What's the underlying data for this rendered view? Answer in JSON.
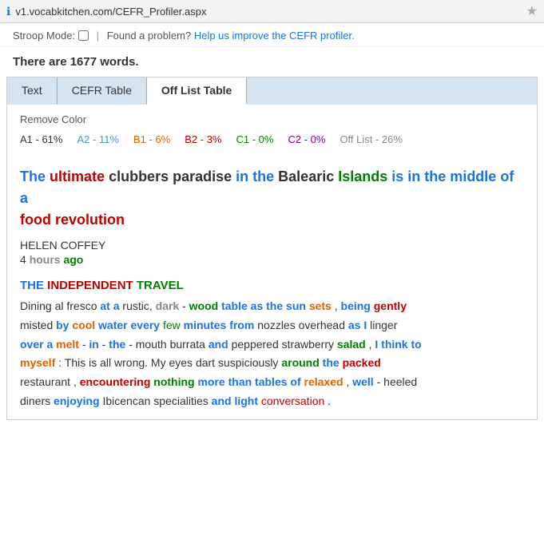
{
  "browser": {
    "url": "v1.vocabkitchen.com/CEFR_Profiler.aspx",
    "star_icon": "★"
  },
  "topbar": {
    "stroop_label": "Stroop Mode:",
    "separator": "|",
    "problem_text": "Found a problem?",
    "help_link": "Help us improve the CEFR profiler."
  },
  "word_count": {
    "text": "There are 1677 words."
  },
  "tabs": {
    "items": [
      {
        "label": "Text",
        "id": "text",
        "active": false
      },
      {
        "label": "CEFR Table",
        "id": "cefr-table",
        "active": false
      },
      {
        "label": "Off List Table",
        "id": "off-list-table",
        "active": true
      }
    ]
  },
  "content": {
    "remove_color": "Remove Color",
    "stats": [
      {
        "label": "A1 - 61%",
        "class": "a1"
      },
      {
        "label": "A2 - 11%",
        "class": "a2"
      },
      {
        "label": "B1 - 6%",
        "class": "b1"
      },
      {
        "label": "B2 - 3%",
        "class": "b2"
      },
      {
        "label": "C1 - 0%",
        "class": "c1"
      },
      {
        "label": "C2 - 0%",
        "class": "c2"
      },
      {
        "label": "Off List - 26%",
        "class": "offlist"
      }
    ],
    "article": {
      "author": "HELEN COFFEY",
      "time_number": "4",
      "time_word": "hours",
      "time_suffix": "ago",
      "source": "THE INDEPENDENT TRAVEL"
    }
  }
}
